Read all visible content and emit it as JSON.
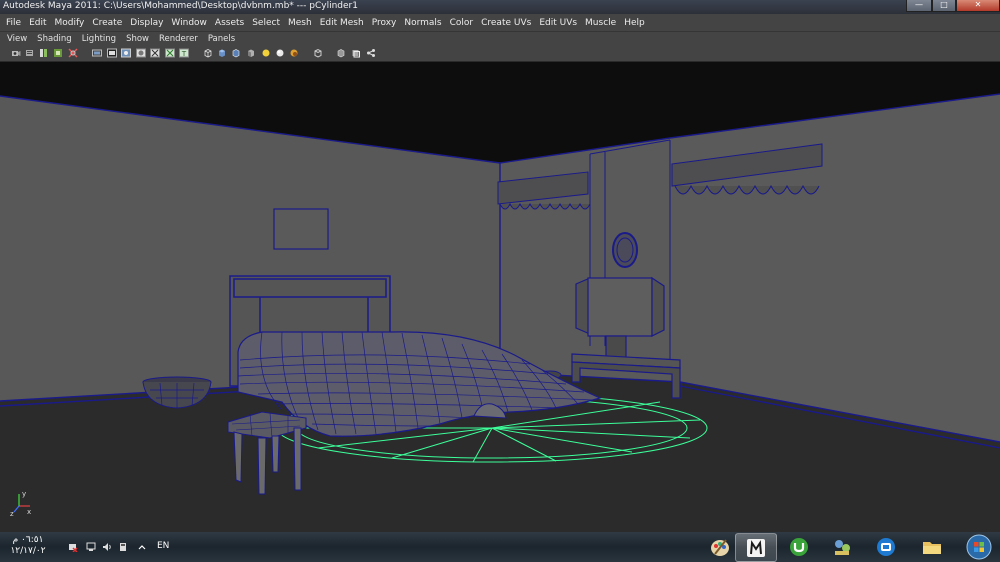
{
  "window": {
    "title": "Autodesk Maya 2011: C:\\Users\\Mohammed\\Desktop\\dvbnm.mb*   ---   pCylinder1"
  },
  "menubar": {
    "items": [
      "File",
      "Edit",
      "Modify",
      "Create",
      "Display",
      "Window",
      "Assets",
      "Select",
      "Mesh",
      "Edit Mesh",
      "Proxy",
      "Normals",
      "Color",
      "Create UVs",
      "Edit UVs",
      "Muscle",
      "Help"
    ]
  },
  "panel_menu": {
    "items": [
      "View",
      "Shading",
      "Lighting",
      "Show",
      "Renderer",
      "Panels"
    ]
  },
  "toolbar_icons": [
    "camera-select-icon",
    "camera-attr-icon",
    "bookmark-icon",
    "image-plane-icon",
    "grid-icon",
    "film-gate-icon",
    "resolution-gate-icon",
    "gate-mask-icon",
    "field-chart-icon",
    "safe-action-icon",
    "safe-title-icon",
    "wireframe-icon",
    "smooth-shade-icon",
    "shaded-wireframe-icon",
    "default-light-icon",
    "all-lights-icon",
    "shadows-icon",
    "xray-icon",
    "isolate-select-icon",
    "hud-icon"
  ],
  "viewport": {
    "axis_labels": {
      "x": "x",
      "y": "y",
      "z": "z"
    },
    "colors": {
      "wire": "#1c1c8c",
      "selected_wire": "#3cff9a",
      "wall": "#585858",
      "floor": "#2c2c2c",
      "ceiling": "#0e0e0e"
    }
  },
  "taskbar": {
    "time": "٠٦:٥١ م",
    "date": "١٢/١٧/٠٢",
    "language": "EN",
    "apps": [
      "paint-app-icon",
      "maya-app-icon",
      "utorrent-app-icon",
      "network-app-icon",
      "maxthon-app-icon",
      "explorer-app-icon",
      "start-orb-icon"
    ],
    "active_app_index": 1
  }
}
